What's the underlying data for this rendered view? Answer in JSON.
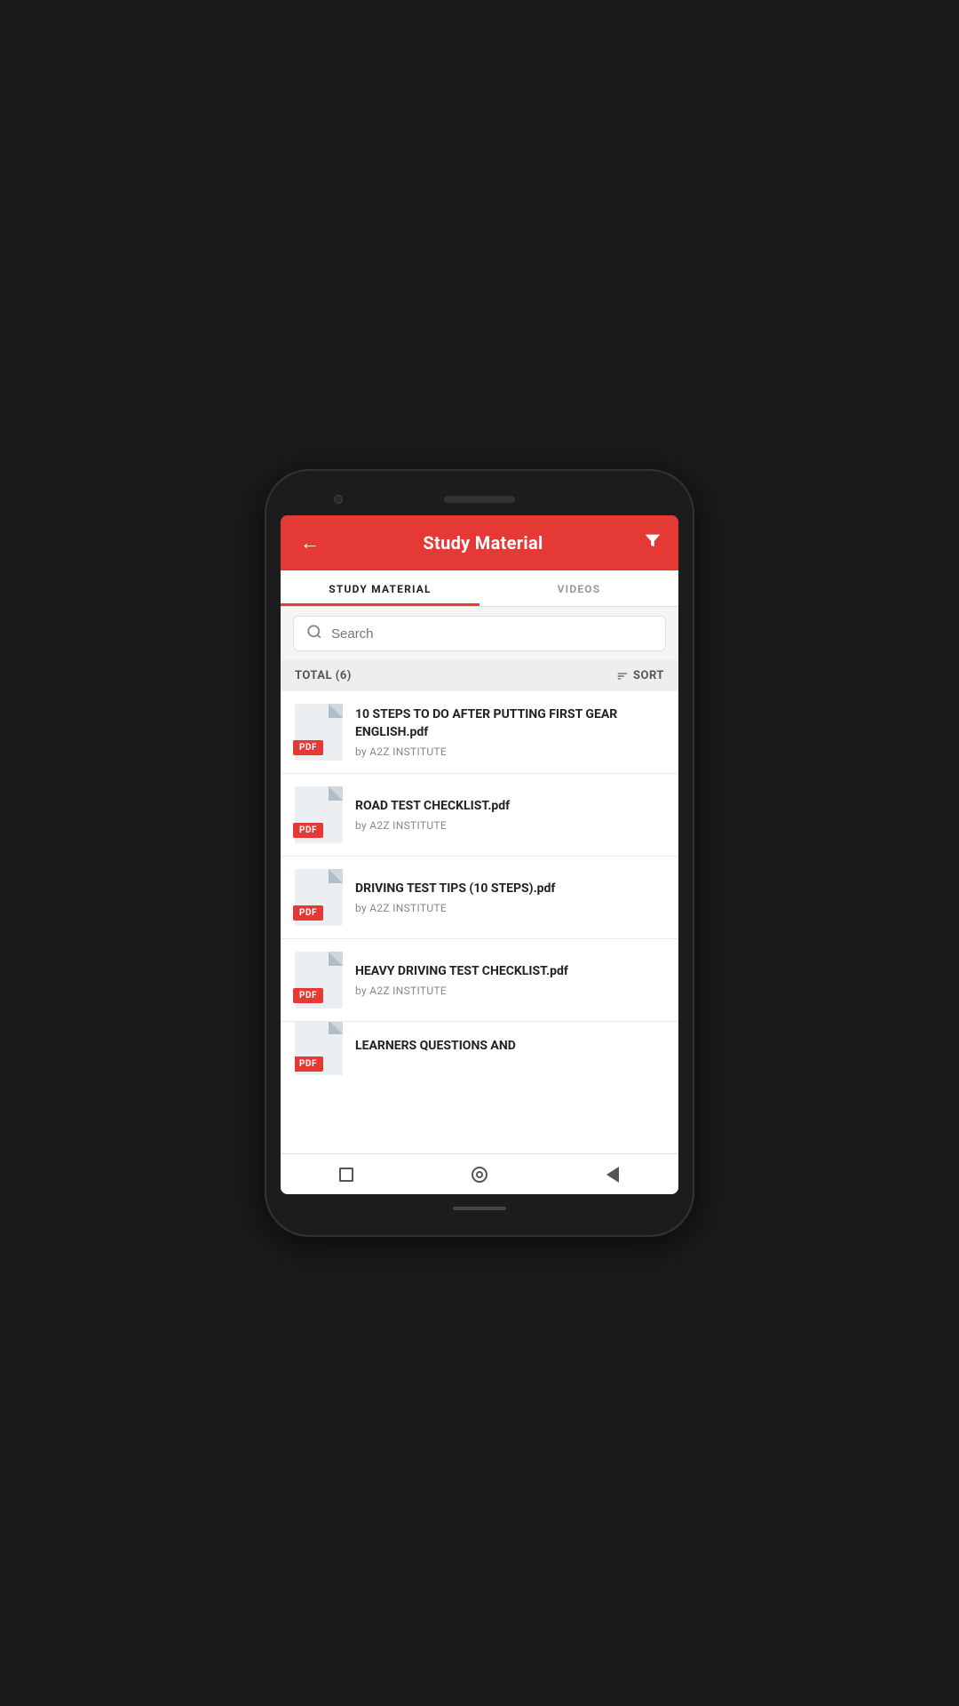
{
  "header": {
    "title": "Study Material",
    "back_label": "←",
    "filter_label": "▼"
  },
  "tabs": [
    {
      "id": "study-material",
      "label": "STUDY MATERIAL",
      "active": true
    },
    {
      "id": "videos",
      "label": "VIDEOS",
      "active": false
    }
  ],
  "search": {
    "placeholder": "Search"
  },
  "list_meta": {
    "total_label": "TOTAL (6)",
    "sort_label": "SORT"
  },
  "files": [
    {
      "title": "10  STEPS TO DO AFTER PUTTING FIRST GEAR ENGLISH.pdf",
      "author": "by A2Z INSTITUTE",
      "badge": "PDF"
    },
    {
      "title": "ROAD TEST CHECKLIST.pdf",
      "author": "by A2Z INSTITUTE",
      "badge": "PDF"
    },
    {
      "title": "DRIVING TEST TIPS (10 STEPS).pdf",
      "author": "by A2Z INSTITUTE",
      "badge": "PDF"
    },
    {
      "title": "HEAVY DRIVING TEST CHECKLIST.pdf",
      "author": "by A2Z INSTITUTE",
      "badge": "PDF"
    },
    {
      "title": "LEARNERS QUESTIONS AND",
      "author": "",
      "badge": "PDF"
    }
  ],
  "colors": {
    "accent": "#e53935",
    "text_primary": "#222222",
    "text_secondary": "#888888"
  }
}
